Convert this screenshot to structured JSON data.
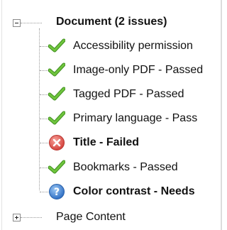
{
  "tree": {
    "root": {
      "label": "Document (2 issues)",
      "expanded": true
    },
    "children": [
      {
        "label": "Accessibility permission",
        "status": "passed",
        "icon": "check-icon"
      },
      {
        "label": "Image-only PDF - Passed",
        "status": "passed",
        "icon": "check-icon"
      },
      {
        "label": "Tagged PDF - Passed",
        "status": "passed",
        "icon": "check-icon"
      },
      {
        "label": "Primary language - Pass",
        "status": "passed",
        "icon": "check-icon"
      },
      {
        "label": "Title - Failed",
        "status": "failed",
        "icon": "error-icon"
      },
      {
        "label": "Bookmarks - Passed",
        "status": "passed",
        "icon": "check-icon"
      },
      {
        "label": "Color contrast - Needs",
        "status": "needs-check",
        "icon": "help-icon"
      }
    ],
    "sibling": {
      "label": "Page Content",
      "expanded": false
    }
  },
  "colors": {
    "check": "#58b030",
    "failed": "#e0504c",
    "help": "#3a7fcf"
  }
}
